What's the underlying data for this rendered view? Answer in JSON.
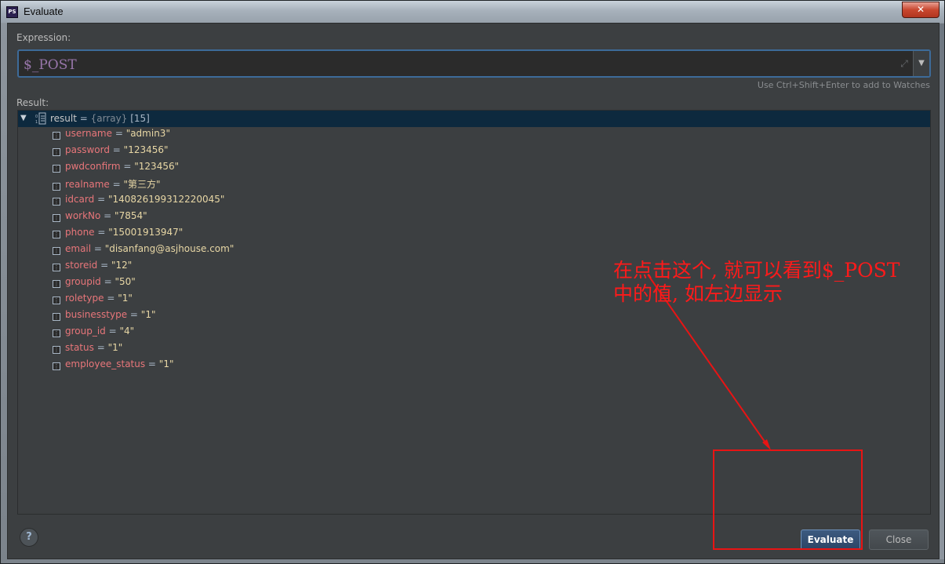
{
  "window": {
    "title": "Evaluate",
    "icon_text": "PS",
    "close_glyph": "✕"
  },
  "expression": {
    "label": "Expression:",
    "value": "$_POST",
    "hint": "Use Ctrl+Shift+Enter to add to Watches"
  },
  "result": {
    "label": "Result:",
    "root": {
      "name": "result",
      "eq": " = ",
      "type": "{array}",
      "count": " [15]"
    },
    "items": [
      {
        "name": "username",
        "value": "\"admin3\""
      },
      {
        "name": "password",
        "value": "\"123456\""
      },
      {
        "name": "pwdconfirm",
        "value": "\"123456\""
      },
      {
        "name": "realname",
        "value": "\"第三方\""
      },
      {
        "name": "idcard",
        "value": "\"140826199312220045\""
      },
      {
        "name": "workNo",
        "value": "\"7854\""
      },
      {
        "name": "phone",
        "value": "\"15001913947\""
      },
      {
        "name": "email",
        "value": "\"disanfang@asjhouse.com\""
      },
      {
        "name": "storeid",
        "value": "\"12\""
      },
      {
        "name": "groupid",
        "value": "\"50\""
      },
      {
        "name": "roletype",
        "value": "\"1\""
      },
      {
        "name": "businesstype",
        "value": "\"1\""
      },
      {
        "name": "group_id",
        "value": "\"4\""
      },
      {
        "name": "status",
        "value": "\"1\""
      },
      {
        "name": "employee_status",
        "value": "\"1\""
      }
    ]
  },
  "buttons": {
    "help": "?",
    "evaluate": "Evaluate",
    "close": "Close"
  },
  "annotation": {
    "line1": "在点击这个, 就可以看到$_POST",
    "line2": "中的值, 如左边显示",
    "color": "#ff1a1a"
  },
  "colors": {
    "selection": "#0d293e",
    "var_name": "#e8767a",
    "var_value": "#e8d7a5",
    "expression_text": "#9876aa"
  }
}
